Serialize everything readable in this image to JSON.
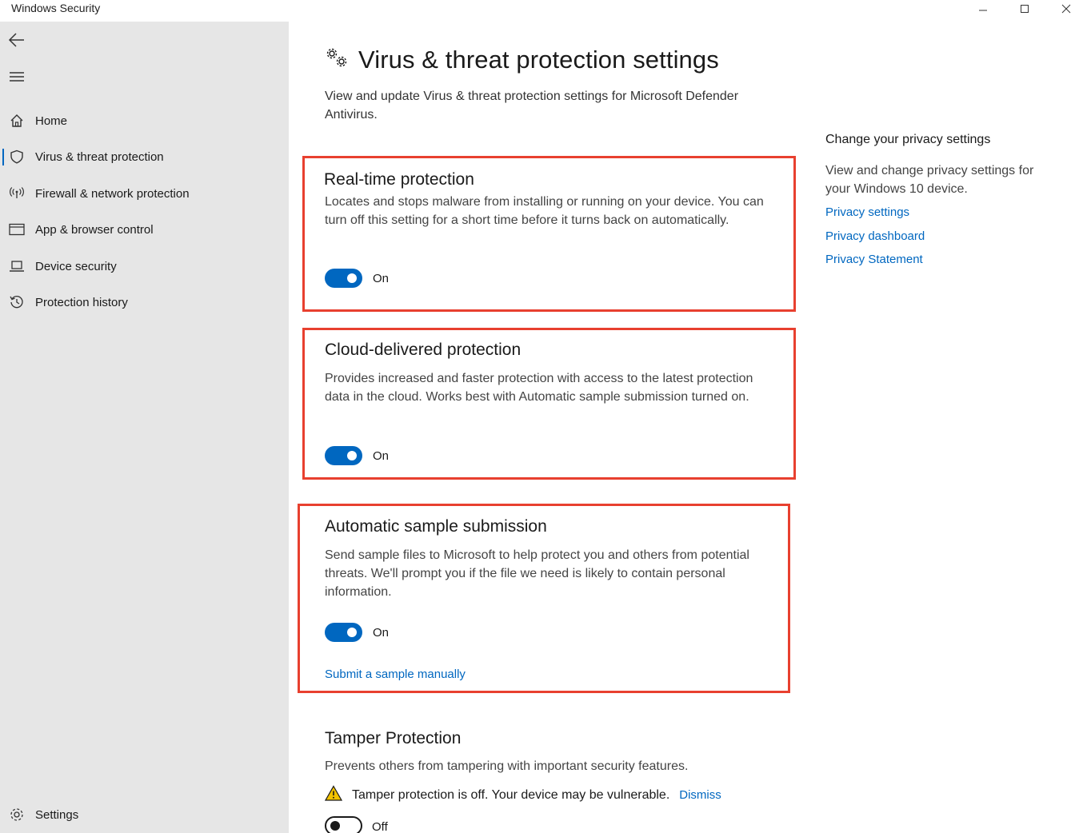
{
  "window": {
    "title": "Windows Security"
  },
  "sidebar": {
    "items": [
      {
        "label": "Home",
        "icon": "home-icon"
      },
      {
        "label": "Virus & threat protection",
        "icon": "shield-icon",
        "active": true
      },
      {
        "label": "Firewall & network protection",
        "icon": "antenna-icon"
      },
      {
        "label": "App & browser control",
        "icon": "browser-window-icon"
      },
      {
        "label": "Device security",
        "icon": "laptop-icon"
      },
      {
        "label": "Protection history",
        "icon": "history-icon"
      }
    ],
    "settings_label": "Settings"
  },
  "main": {
    "title": "Virus & threat protection settings",
    "description": "View and update Virus & threat protection settings for Microsoft Defender Antivirus.",
    "sections": {
      "realtime": {
        "title": "Real-time protection",
        "description": "Locates and stops malware from installing or running on your device. You can turn off this setting for a short time before it turns back on automatically.",
        "toggle_state": "On"
      },
      "cloud": {
        "title": "Cloud-delivered protection",
        "description": "Provides increased and faster protection with access to the latest protection data in the cloud. Works best with Automatic sample submission turned on.",
        "toggle_state": "On"
      },
      "sample": {
        "title": "Automatic sample submission",
        "description": "Send sample files to Microsoft to help protect you and others from potential threats. We'll prompt you if the file we need is likely to contain personal information.",
        "toggle_state": "On",
        "link": "Submit a sample manually"
      },
      "tamper": {
        "title": "Tamper Protection",
        "description": "Prevents others from tampering with important security features.",
        "warning": "Tamper protection is off. Your device may be vulnerable.",
        "dismiss": "Dismiss",
        "toggle_state": "Off"
      }
    }
  },
  "right_pane": {
    "title": "Change your privacy settings",
    "description": "View and change privacy settings for your Windows 10 device.",
    "links": [
      "Privacy settings",
      "Privacy dashboard",
      "Privacy Statement"
    ]
  },
  "colors": {
    "accent": "#0067c0",
    "highlight_border": "#e8402f",
    "sidebar_bg": "#e6e6e6",
    "warning": "#f2c200"
  }
}
